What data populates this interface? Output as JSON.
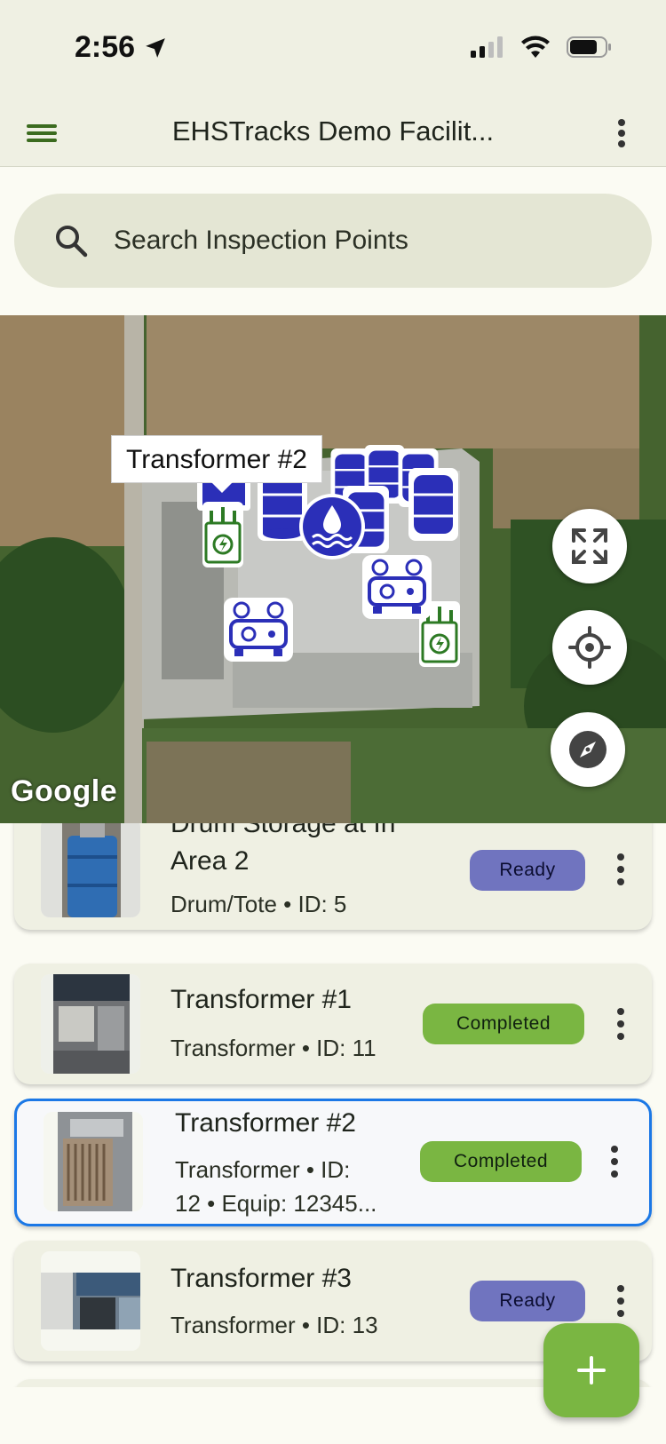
{
  "status_bar": {
    "time": "2:56"
  },
  "app_bar": {
    "title": "EHSTracks Demo Facilit..."
  },
  "search": {
    "placeholder": "Search Inspection Points"
  },
  "map": {
    "callout": "Transformer #2",
    "attribution": "Google",
    "buttons": [
      "fullscreen-icon",
      "my-location-icon",
      "compass-icon"
    ]
  },
  "list": {
    "items": [
      {
        "title_line1": "Drum Storage at In",
        "title_line2": "Area 2",
        "subtitle": "Drum/Tote • ID: 5",
        "status": "Ready"
      },
      {
        "title": "Transformer #1",
        "subtitle": "Transformer • ID: 11",
        "status": "Completed"
      },
      {
        "title": "Transformer #2",
        "subtitle_line1": "Transformer • ID:",
        "subtitle_line2": "12 • Equip: 12345...",
        "status": "Completed",
        "selected": true
      },
      {
        "title": "Transformer #3",
        "subtitle": "Transformer • ID: 13",
        "status": "Ready"
      }
    ]
  },
  "colors": {
    "accent_green": "#7ab642",
    "ready": "#7074bf",
    "selected_border": "#1b78e6",
    "marker_blue": "#2b2fb8"
  }
}
